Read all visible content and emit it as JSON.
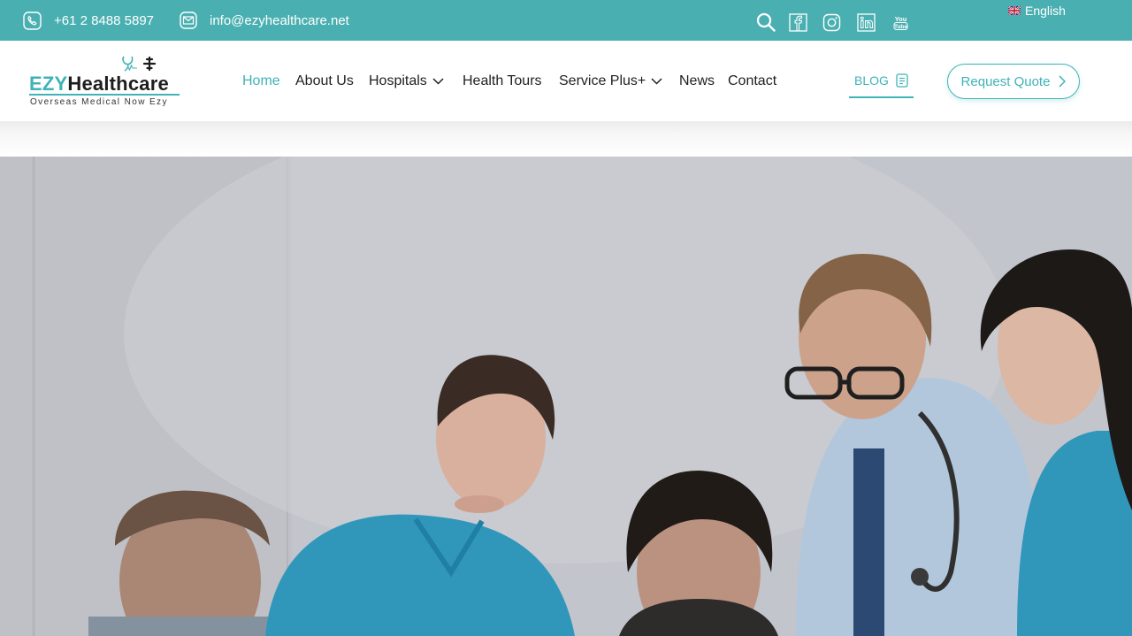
{
  "topbar": {
    "phone": "+61 2 8488 5897",
    "email": "info@ezyhealthcare.net",
    "language": "English",
    "colors": {
      "bar": "#4aafb1",
      "text": "#ffffff"
    }
  },
  "logo": {
    "brand_part1": "EZY",
    "brand_part2": "Healthcare",
    "tagline": "Overseas Medical Now Ezy"
  },
  "nav": {
    "items": [
      {
        "label": "Home",
        "active": true
      },
      {
        "label": "About Us"
      },
      {
        "label": "Hospitals",
        "dropdown": true
      },
      {
        "label": "Health Tours"
      },
      {
        "label": "Service Plus+",
        "dropdown": true
      },
      {
        "label": "News"
      },
      {
        "label": "Contact"
      }
    ],
    "blog_label": "BLOG",
    "quote_label": "Request Quote",
    "accent": "#3fb3b7"
  },
  "icons": {
    "phone": "phone-icon",
    "email": "envelope-icon",
    "search": "search-icon",
    "facebook": "facebook-icon",
    "instagram": "instagram-icon",
    "linkedin": "linkedin-icon",
    "youtube": "youtube-icon",
    "flag": "uk-flag-icon",
    "blog": "document-icon",
    "chevron": "chevron-right-icon"
  }
}
